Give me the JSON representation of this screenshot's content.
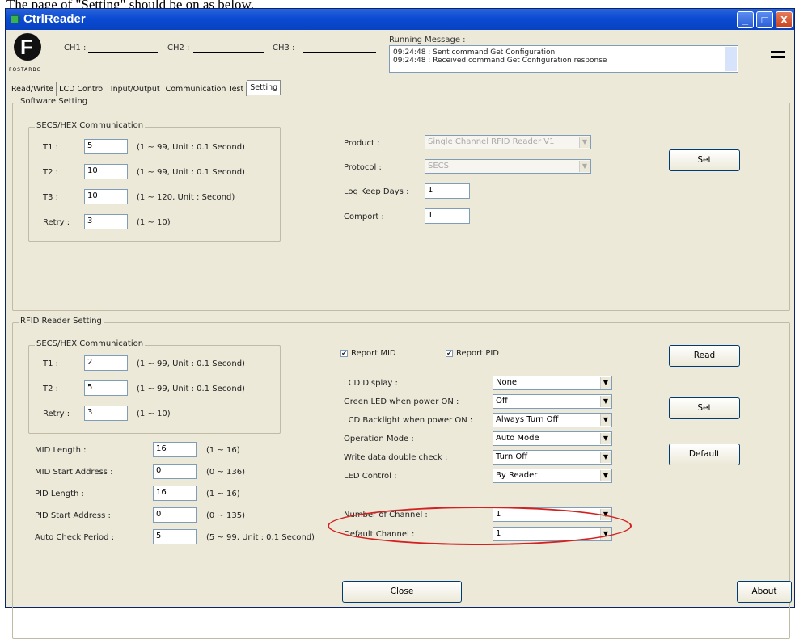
{
  "caption": "The page of \"Setting\" should be on as below.",
  "window": {
    "title": "CtrlReader",
    "min": "_",
    "max": "□",
    "close": "X"
  },
  "logo": {
    "letter": "F",
    "text": "FOSTARBG"
  },
  "channels": [
    "CH1 :",
    "CH2 :",
    "CH3 :"
  ],
  "running": {
    "label": "Running Message :",
    "lines": [
      "09:24:48 : Sent command Get Configuration",
      "09:24:48 : Received command Get Configuration response"
    ]
  },
  "tabs": [
    "Read/Write",
    "LCD Control",
    "Input/Output",
    "Communication Test",
    "Setting"
  ],
  "software": {
    "title": "Software Setting",
    "secs_title": "SECS/HEX Communication",
    "rows": [
      {
        "label": "T1 :",
        "value": "5",
        "hint": "(1 ~ 99, Unit : 0.1 Second)"
      },
      {
        "label": "T2 :",
        "value": "10",
        "hint": "(1 ~ 99, Unit : 0.1 Second)"
      },
      {
        "label": "T3 :",
        "value": "10",
        "hint": "(1 ~ 120, Unit : Second)"
      },
      {
        "label": "Retry :",
        "value": "3",
        "hint": "(1 ~ 10)"
      }
    ],
    "product_label": "Product :",
    "product_value": "Single Channel RFID Reader V1",
    "protocol_label": "Protocol :",
    "protocol_value": "SECS",
    "logkeep_label": "Log Keep Days :",
    "logkeep_value": "1",
    "comport_label": "Comport :",
    "comport_value": "1",
    "set": "Set"
  },
  "rfid": {
    "title": "RFID Reader Setting",
    "secs_title": "SECS/HEX Communication",
    "rows": [
      {
        "label": "T1 :",
        "value": "2",
        "hint": "(1 ~ 99, Unit : 0.1 Second)"
      },
      {
        "label": "T2 :",
        "value": "5",
        "hint": "(1 ~ 99, Unit : 0.1 Second)"
      },
      {
        "label": "Retry :",
        "value": "3",
        "hint": "(1 ~ 10)"
      }
    ],
    "params": [
      {
        "label": "MID Length :",
        "value": "16",
        "hint": "(1 ~ 16)"
      },
      {
        "label": "MID Start Address :",
        "value": "0",
        "hint": "(0 ~ 136)"
      },
      {
        "label": "PID Length :",
        "value": "16",
        "hint": "(1 ~ 16)"
      },
      {
        "label": "PID Start Address :",
        "value": "0",
        "hint": "(0 ~ 135)"
      },
      {
        "label": "Auto Check Period :",
        "value": "5",
        "hint": "(5 ~ 99, Unit : 0.1 Second)"
      }
    ],
    "report_mid": "Report MID",
    "report_pid": "Report PID",
    "options": [
      {
        "label": "LCD Display :",
        "value": "None"
      },
      {
        "label": "Green LED when power ON :",
        "value": "Off"
      },
      {
        "label": "LCD Backlight when power ON :",
        "value": "Always Turn Off"
      },
      {
        "label": "Operation Mode :",
        "value": "Auto Mode"
      },
      {
        "label": "Write data double check :",
        "value": "Turn Off"
      },
      {
        "label": "LED Control :",
        "value": "By Reader"
      },
      {
        "label": "Number of Channel :",
        "value": "1"
      },
      {
        "label": "Default Channel :",
        "value": "1"
      }
    ],
    "read": "Read",
    "set": "Set",
    "default": "Default"
  },
  "footer": {
    "close": "Close",
    "about": "About"
  },
  "colors": {
    "highlight_oval": "#D32020",
    "titlebar": "#0A4BD3"
  }
}
